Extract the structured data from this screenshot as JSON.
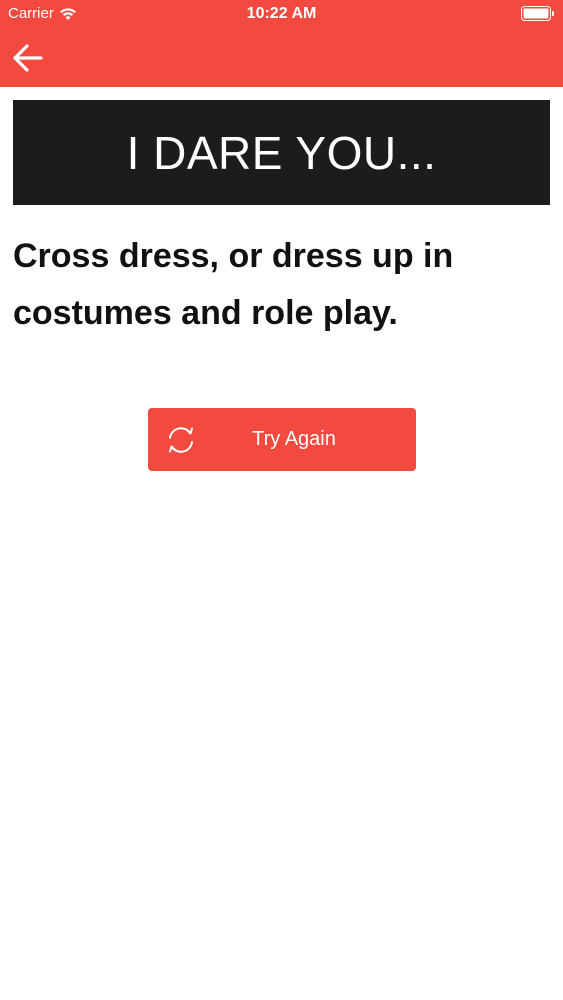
{
  "status_bar": {
    "carrier": "Carrier",
    "time": "10:22 AM"
  },
  "nav": {
    "back_icon": "arrow-left-icon"
  },
  "banner": {
    "text": "I DARE YOU..."
  },
  "dare": {
    "text": "Cross dress, or dress up in costumes and role play."
  },
  "try_again": {
    "label": "Try Again",
    "icon": "refresh-icon"
  },
  "colors": {
    "accent": "#f24a3e",
    "banner_bg": "#1c1c1e",
    "text": "#111111"
  }
}
